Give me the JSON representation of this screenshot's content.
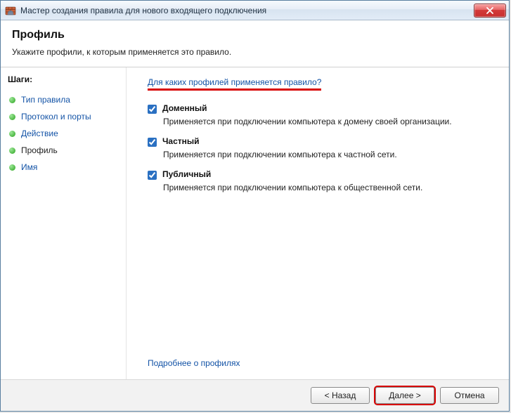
{
  "window": {
    "title": "Мастер создания правила для нового входящего подключения"
  },
  "header": {
    "title": "Профиль",
    "subtitle": "Укажите профили, к которым применяется это правило."
  },
  "steps": {
    "title": "Шаги:",
    "items": [
      {
        "label": "Тип правила",
        "state": "link"
      },
      {
        "label": "Протокол и порты",
        "state": "link"
      },
      {
        "label": "Действие",
        "state": "link"
      },
      {
        "label": "Профиль",
        "state": "current"
      },
      {
        "label": "Имя",
        "state": "link"
      }
    ]
  },
  "content": {
    "question": "Для каких профилей применяется правило?",
    "profiles": [
      {
        "name_key": "domain",
        "label": "Доменный",
        "desc": "Применяется при подключении компьютера к домену своей организации.",
        "checked": true
      },
      {
        "name_key": "private",
        "label": "Частный",
        "desc": "Применяется при подключении компьютера к частной сети.",
        "checked": true
      },
      {
        "name_key": "public",
        "label": "Публичный",
        "desc": "Применяется при подключении компьютера к общественной сети.",
        "checked": true
      }
    ],
    "learn_more": "Подробнее о профилях"
  },
  "footer": {
    "back": "< Назад",
    "next": "Далее >",
    "cancel": "Отмена"
  }
}
